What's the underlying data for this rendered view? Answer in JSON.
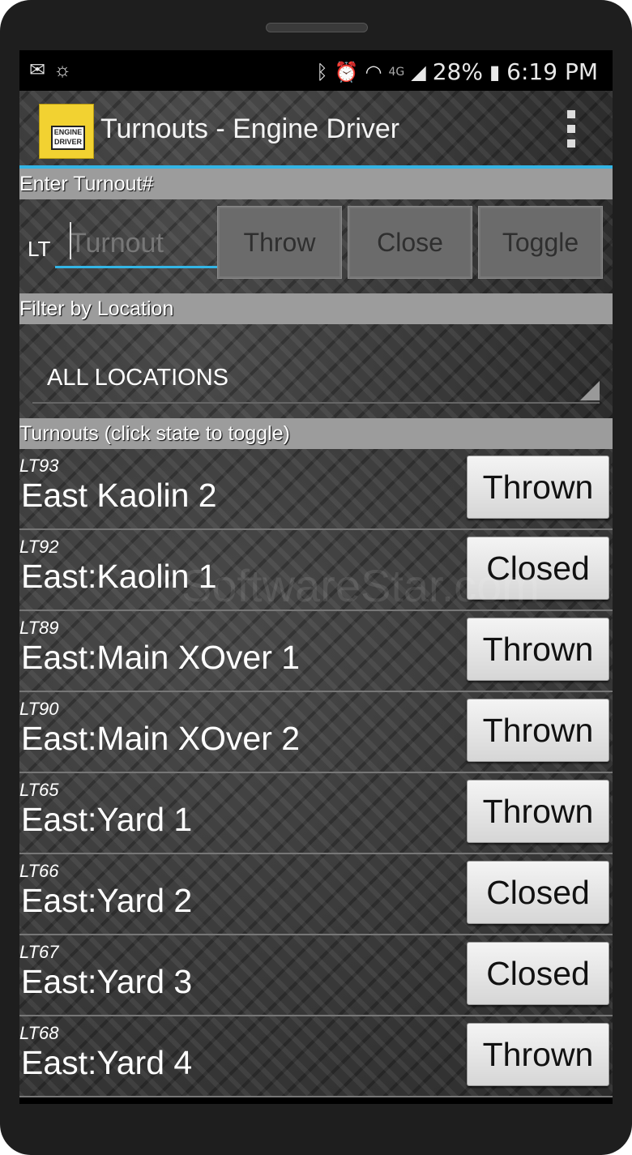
{
  "statusbar": {
    "left_icons": [
      "gmail-icon",
      "weather-icon"
    ],
    "right_icons": [
      "bluetooth-icon",
      "alarm-icon",
      "wifi-icon",
      "4g-icon",
      "signal-icon",
      "battery-icon"
    ],
    "network_label": "4G",
    "battery_percent": "28%",
    "time": "6:19 PM"
  },
  "appbar": {
    "title": "Turnouts - Engine Driver",
    "icon_text": "ENGINE DRIVER",
    "menu_icon": "overflow-menu-icon"
  },
  "enter_section": {
    "header": "Enter Turnout#",
    "prefix": "LT",
    "input_placeholder": "Turnout",
    "input_value": "",
    "buttons": [
      "Throw",
      "Close",
      "Toggle"
    ]
  },
  "filter_section": {
    "header": "Filter by Location",
    "selected_location": "ALL LOCATIONS"
  },
  "turnouts_section": {
    "header": "Turnouts (click state to toggle)",
    "rows": [
      {
        "id": "LT93",
        "name": "East Kaolin 2",
        "state": "Thrown"
      },
      {
        "id": "LT92",
        "name": "East:Kaolin 1",
        "state": "Closed"
      },
      {
        "id": "LT89",
        "name": "East:Main XOver 1",
        "state": "Thrown"
      },
      {
        "id": "LT90",
        "name": "East:Main XOver 2",
        "state": "Thrown"
      },
      {
        "id": "LT65",
        "name": "East:Yard 1",
        "state": "Thrown"
      },
      {
        "id": "LT66",
        "name": "East:Yard 2",
        "state": "Closed"
      },
      {
        "id": "LT67",
        "name": "East:Yard 3",
        "state": "Closed"
      },
      {
        "id": "LT68",
        "name": "East:Yard 4",
        "state": "Thrown"
      }
    ]
  },
  "watermark": "SoftwareStar.com",
  "colors": {
    "accent": "#33b5e5",
    "section_header_bg": "#9c9c9c",
    "state_button_bg": "#e6e6e6",
    "disabled_button_bg": "#6b6b6b"
  }
}
